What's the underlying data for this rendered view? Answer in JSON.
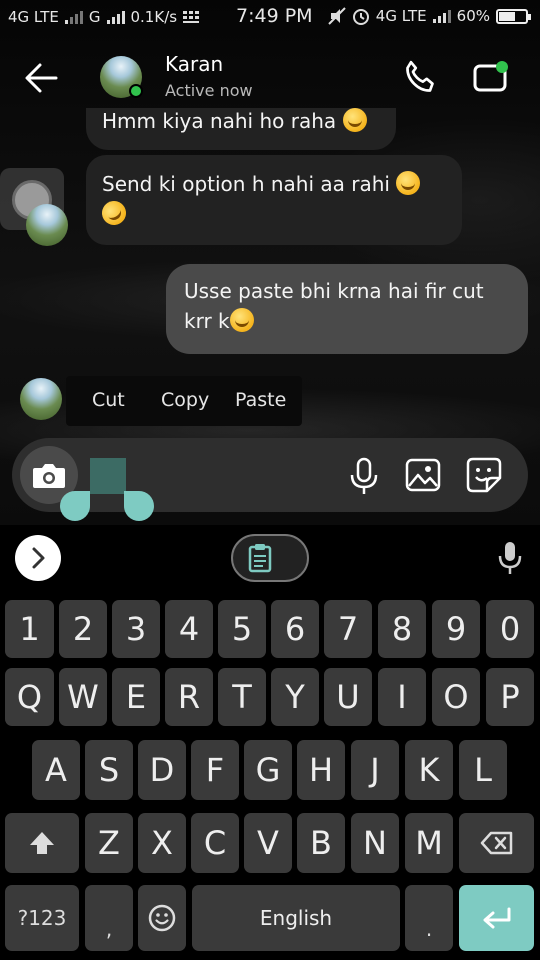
{
  "status_bar": {
    "network_left": "4G LTE",
    "network_mid": "G",
    "speed": "0.1K/s",
    "time": "7:49 PM",
    "network_right": "4G LTE",
    "battery": "60%",
    "battery_level": 0.6
  },
  "header": {
    "contact_name": "Karan",
    "contact_status": "Active now"
  },
  "messages": [
    {
      "direction": "incoming",
      "text": "Hmm kiya nahi ho raha",
      "emoji": "smiling-face-icon"
    },
    {
      "direction": "incoming",
      "text": "Send ki option h nahi aa rahi",
      "emoji": "smiling-face-icon",
      "emoji2": "rofl-face-icon"
    },
    {
      "direction": "outgoing",
      "text_line1": "Usse paste bhi krna hai fir cut",
      "text_line2": "krr k",
      "emoji": "smiling-face-icon"
    }
  ],
  "context_menu": {
    "items": [
      "Cut",
      "Copy",
      "Paste"
    ]
  },
  "keyboard": {
    "row_numbers": [
      "1",
      "2",
      "3",
      "4",
      "5",
      "6",
      "7",
      "8",
      "9",
      "0"
    ],
    "row_top": [
      "Q",
      "W",
      "E",
      "R",
      "T",
      "Y",
      "U",
      "I",
      "O",
      "P"
    ],
    "row_middle": [
      "A",
      "S",
      "D",
      "F",
      "G",
      "H",
      "J",
      "K",
      "L"
    ],
    "row_bottom": [
      "Z",
      "X",
      "C",
      "V",
      "B",
      "N",
      "M"
    ],
    "symbols_key": "?123",
    "comma_key": ",",
    "space_label": "English",
    "period_key": "."
  },
  "colors": {
    "accent": "#7ecbc2",
    "online": "#31c24d",
    "incoming_bubble": "#222222",
    "outgoing_bubble": "#4a4a4a",
    "key_bg": "#3a3a3a"
  }
}
